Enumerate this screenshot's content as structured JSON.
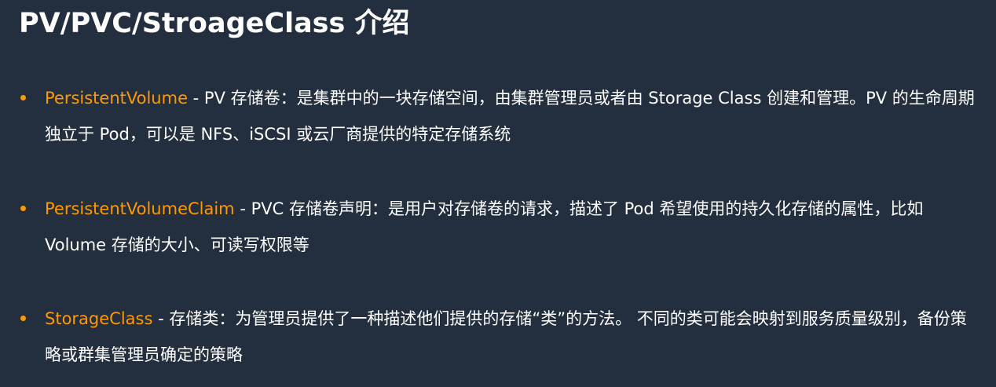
{
  "slide": {
    "title": "PV/PVC/StroageClass 介绍",
    "accent_color": "#ff9900",
    "background_color": "#232f3e",
    "bullets": [
      {
        "term": "PersistentVolume",
        "description": " - PV 存储卷：是集群中的一块存储空间，由集群管理员或者由 Storage Class 创建和管理。PV 的生命周期独立于 Pod，可以是 NFS、iSCSI 或云厂商提供的特定存储系统"
      },
      {
        "term": "PersistentVolumeClaim",
        "description": " - PVC 存储卷声明：是用户对存储卷的请求，描述了 Pod 希望使用的持久化存储的属性，比如 Volume 存储的大小、可读写权限等"
      },
      {
        "term": "StorageClass",
        "description": " - 存储类：为管理员提供了一种描述他们提供的存储“类”的方法。 不同的类可能会映射到服务质量级别，备份策略或群集管理员确定的策略"
      }
    ]
  }
}
